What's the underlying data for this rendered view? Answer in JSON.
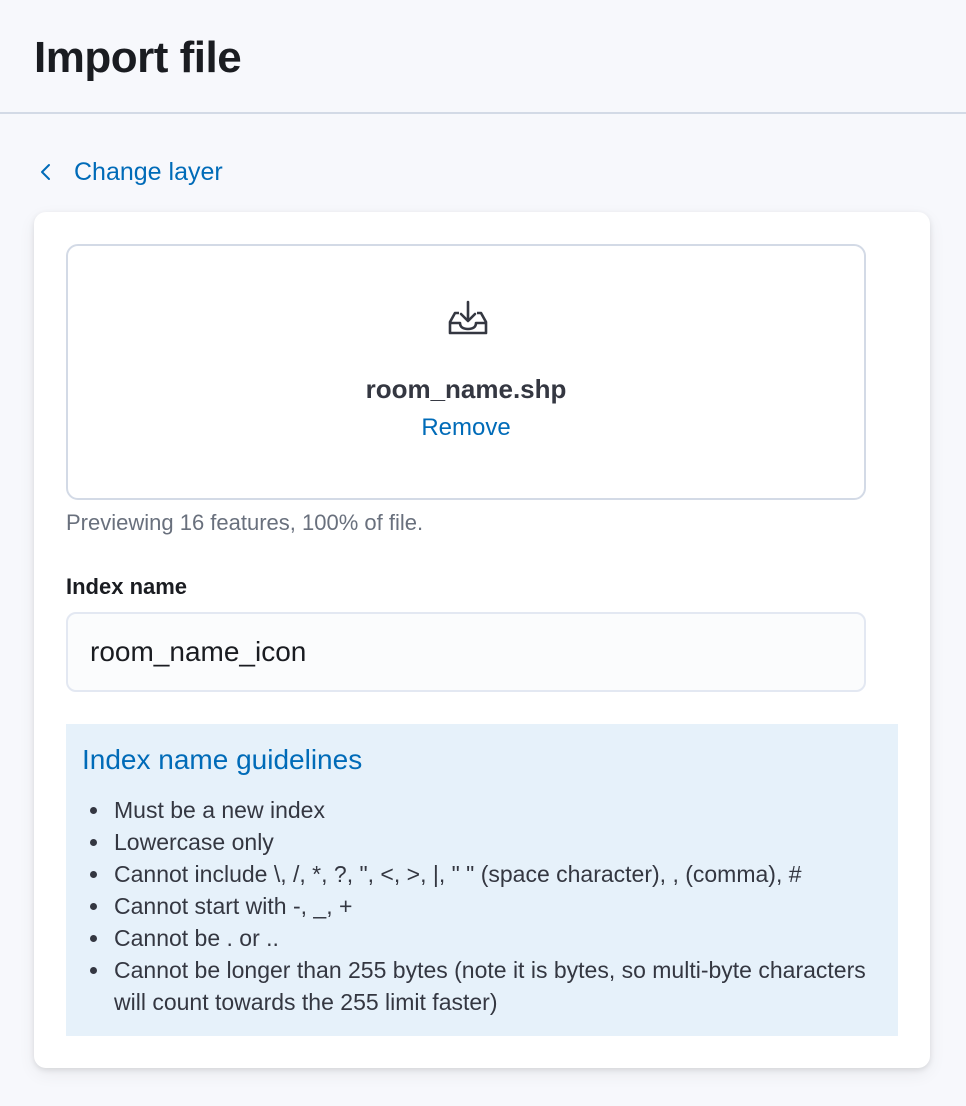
{
  "header": {
    "title": "Import file"
  },
  "back": {
    "label": "Change layer",
    "icon": "chevron-left-icon"
  },
  "dropzone": {
    "icon": "import-icon",
    "filename": "room_name.shp",
    "remove_label": "Remove"
  },
  "preview_text": "Previewing 16 features, 100% of file.",
  "index_field": {
    "label": "Index name",
    "value": "room_name_icon"
  },
  "guidelines": {
    "title": "Index name guidelines",
    "items": [
      "Must be a new index",
      "Lowercase only",
      "Cannot include \\, /, *, ?, \", <, >, |, \" \" (space character), , (comma), #",
      "Cannot start with -, _, +",
      "Cannot be . or ..",
      "Cannot be longer than 255 bytes (note it is bytes, so multi-byte characters will count towards the 255 limit faster)"
    ]
  },
  "colors": {
    "link": "#006bb8",
    "guidelines_bg": "#e6f1fa",
    "page_bg": "#f7f8fc"
  }
}
